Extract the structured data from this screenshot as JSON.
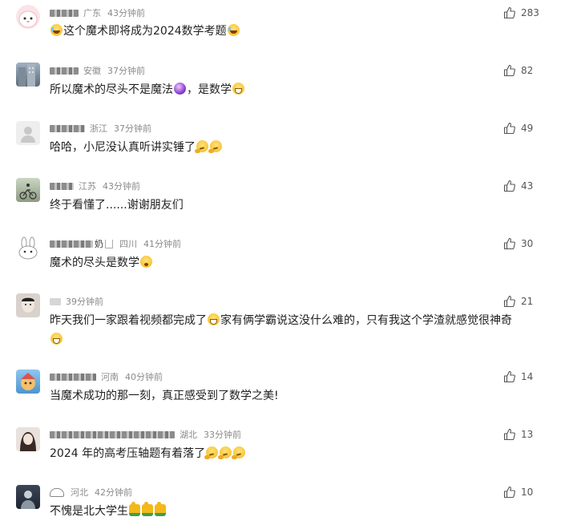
{
  "comments": [
    {
      "region": "广东",
      "time": "43分钟前",
      "likes": "283",
      "text_before": "",
      "text_after": "这个魔术即将成为2024数学考题",
      "avatar": "pink-bunny-avatar"
    },
    {
      "region": "安徽",
      "time": "37分钟前",
      "likes": "82",
      "text_before": "所以魔术的尽头不是魔法",
      "text_after": "，是数学",
      "avatar": "building-photo-avatar"
    },
    {
      "region": "浙江",
      "time": "37分钟前",
      "likes": "49",
      "text_before": "哈哈，小尼没认真听讲实锤了",
      "text_after": "",
      "avatar": "default-user-avatar"
    },
    {
      "region": "江苏",
      "time": "43分钟前",
      "likes": "43",
      "text_before": "终于看懂了......谢谢朋友们",
      "text_after": "",
      "avatar": "cyclist-photo-avatar"
    },
    {
      "region": "四川",
      "time": "41分钟前",
      "likes": "30",
      "text_before": "魔术的尽头是数学",
      "text_after": "",
      "avatar": "white-rabbit-avatar",
      "name_tail": "奶"
    },
    {
      "region": "",
      "time": "39分钟前",
      "likes": "21",
      "text_before": "昨天我们一家跟着视频都完成了",
      "text_mid": "家有俩学霸说这没什么难的，只有我这个学渣就感觉很神奇",
      "text_after": "",
      "avatar": "man-portrait-avatar"
    },
    {
      "region": "河南",
      "time": "40分钟前",
      "likes": "14",
      "text_before": "当魔术成功的那一刻，真正感受到了数学之美!",
      "text_after": "",
      "avatar": "cartoon-character-avatar"
    },
    {
      "region": "湖北",
      "time": "33分钟前",
      "likes": "13",
      "text_before": "2024 年的高考压轴题有着落了",
      "text_after": "",
      "avatar": "girl-photo-avatar"
    },
    {
      "region": "河北",
      "time": "42分钟前",
      "likes": "10",
      "text_before": "不愧是北大学生",
      "text_after": "",
      "avatar": "dark-figure-avatar"
    }
  ]
}
